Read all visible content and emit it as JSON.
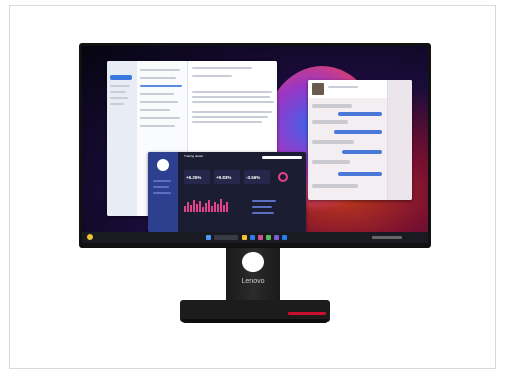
{
  "dashboard": {
    "title": "Trading dealer",
    "stats": [
      "+6.25%",
      "+9.83%",
      "-3.56%"
    ]
  },
  "monitor": {
    "brand": "Lenovo"
  },
  "colors": {
    "accent_red": "#c8102e",
    "chart_pink": "#e2438a",
    "nav_blue": "#2d3f8f"
  }
}
